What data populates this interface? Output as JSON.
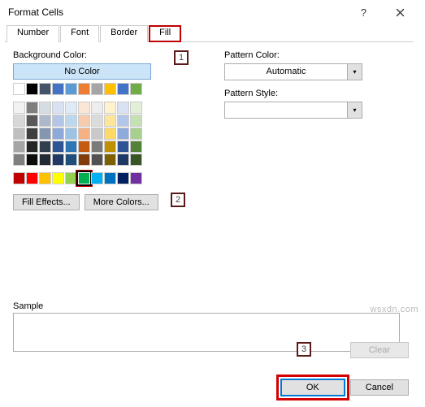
{
  "title": "Format Cells",
  "help_glyph": "?",
  "tabs": {
    "number": "Number",
    "font": "Font",
    "border": "Border",
    "fill": "Fill"
  },
  "bg_color_label": "Background Color:",
  "no_color": "No Color",
  "pattern_color_label": "Pattern Color:",
  "pattern_style_label": "Pattern Style:",
  "automatic": "Automatic",
  "fill_effects": "Fill Effects...",
  "more_colors": "More Colors...",
  "sample": "Sample",
  "clear": "Clear",
  "ok": "OK",
  "cancel": "Cancel",
  "annotations": {
    "a1": "1",
    "a2": "2",
    "a3": "3"
  },
  "watermark": "wsxdn.com",
  "theme_colors": [
    [
      "#ffffff",
      "#000000",
      "#44546a",
      "#4472c4",
      "#5b9bd5",
      "#ed7d31",
      "#a5a5a5",
      "#ffc000",
      "#4472c4",
      "#70ad47"
    ],
    [
      "#f2f2f2",
      "#7f7f7f",
      "#d6dce4",
      "#d9e2f3",
      "#deebf6",
      "#fbe5d5",
      "#ededed",
      "#fff2cc",
      "#d9e2f3",
      "#e2efd9"
    ],
    [
      "#d8d8d8",
      "#595959",
      "#adb9ca",
      "#b4c6e7",
      "#bdd7ee",
      "#f7cbac",
      "#dbdbdb",
      "#fee599",
      "#b4c6e7",
      "#c5e0b3"
    ],
    [
      "#bfbfbf",
      "#3f3f3f",
      "#8496b0",
      "#8eaadb",
      "#9cc3e5",
      "#f4b183",
      "#c9c9c9",
      "#ffd965",
      "#8eaadb",
      "#a8d08d"
    ],
    [
      "#a5a5a5",
      "#262626",
      "#323f4f",
      "#2f5496",
      "#2e75b5",
      "#c55a11",
      "#7b7b7b",
      "#bf9000",
      "#2f5496",
      "#538135"
    ],
    [
      "#7f7f7f",
      "#0c0c0c",
      "#222a35",
      "#1f3864",
      "#1e4e79",
      "#833c0b",
      "#525252",
      "#7f6000",
      "#1f3864",
      "#375623"
    ]
  ],
  "standard_colors": [
    "#c00000",
    "#ff0000",
    "#ffc000",
    "#ffff00",
    "#92d050",
    "#00b050",
    "#00b0f0",
    "#0070c0",
    "#002060",
    "#7030a0"
  ],
  "selected_standard_index": 5
}
